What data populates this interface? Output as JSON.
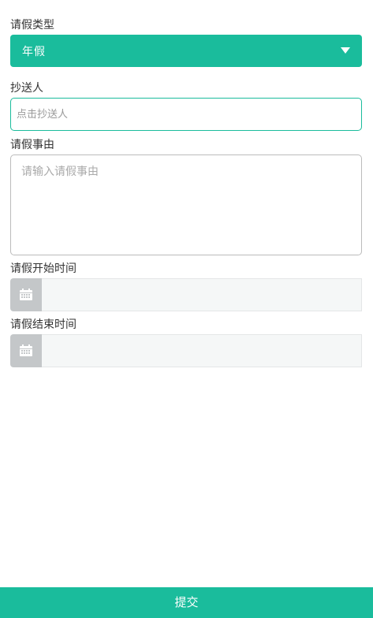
{
  "leave_type": {
    "label": "请假类型",
    "selected": "年假",
    "icon": "caret-down-icon"
  },
  "cc": {
    "label": "抄送人",
    "placeholder": "点击抄送人",
    "value": ""
  },
  "reason": {
    "label": "请假事由",
    "placeholder": "请输入请假事由",
    "value": ""
  },
  "start_time": {
    "label": "请假开始时间",
    "value": "",
    "icon": "calendar-icon"
  },
  "end_time": {
    "label": "请假结束时间",
    "value": "",
    "icon": "calendar-icon"
  },
  "submit": {
    "label": "提交"
  },
  "colors": {
    "accent": "#1abc9c",
    "addon": "#c4c7c9",
    "date_bg": "#f5f7f7"
  }
}
